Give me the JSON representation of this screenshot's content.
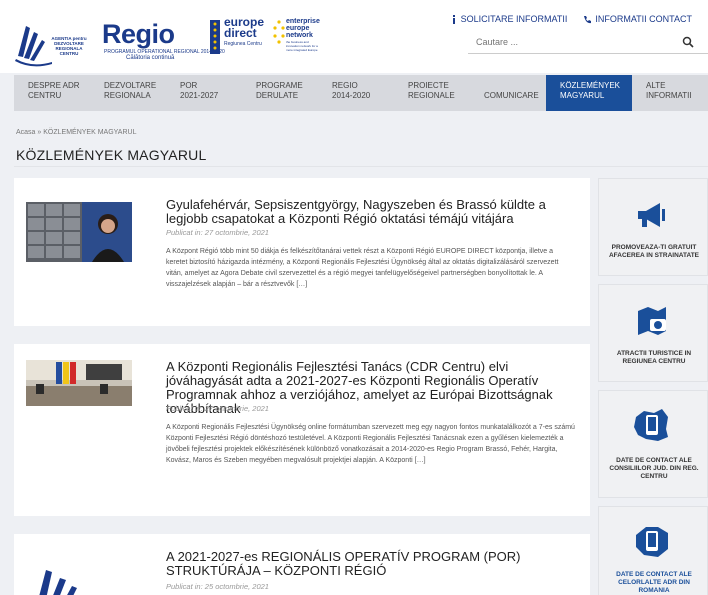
{
  "header": {
    "adr_logo_text": "AGENTIA pentru DEZVOLTARE REGIONALA CENTRU",
    "regio_logo_text": "Regio",
    "regio_logo_sub": "PROGRAMUL OPERATIONAL REGIONAL 2014-2020",
    "regio_logo_tagline": "Călătoria continuă",
    "europe_direct_line1": "europe",
    "europe_direct_line2": "direct",
    "europe_direct_sub": "Regiunea Centru",
    "een_text": "enterprise europe network",
    "een_footer": "the business and innovation network for a more integrated Europe",
    "links": [
      {
        "label": "SOLICITARE INFORMATII",
        "icon": "info-icon"
      },
      {
        "label": "INFORMATII CONTACT",
        "icon": "phone-icon"
      }
    ],
    "search_placeholder": "Cautare ..."
  },
  "nav": [
    {
      "line1": "DESPRE ADR",
      "line2": "CENTRU",
      "active": false
    },
    {
      "line1": "DEZVOLTARE",
      "line2": "REGIONALA",
      "active": false
    },
    {
      "line1": "POR",
      "line2": "2021-2027",
      "active": false
    },
    {
      "line1": "PROGRAME",
      "line2": "DERULATE",
      "active": false
    },
    {
      "line1": "REGIO",
      "line2": "2014-2020",
      "active": false
    },
    {
      "line1": "PROIECTE",
      "line2": "REGIONALE",
      "active": false
    },
    {
      "line1": "",
      "line2": "COMUNICARE",
      "active": false
    },
    {
      "line1": "KÖZLEMÉNYEK",
      "line2": "MAGYARUL",
      "active": true
    },
    {
      "line1": "ALTE",
      "line2": "INFORMATII",
      "active": false
    }
  ],
  "breadcrumb": "Acasa » KÖZLEMÉNYEK MAGYARUL",
  "page_title": "KÖZLEMÉNYEK MAGYARUL",
  "articles": [
    {
      "title": "Gyulafehérvár, Sepsiszentgyörgy, Nagyszeben és Brassó küldte a legjobb csapatokat a Központi Régió oktatási témájú vitájára",
      "date": "Publicat in: 27 octombrie, 2021",
      "excerpt": "A Központ Régió több mint 50 diákja és felkészítőtanárai vettek részt a Központi Régió EUROPE DIRECT központja, illetve a keretet biztosító házigazda intézmény, a Központi Regionális Fejlesztési Ügynökség által az oktatás digitalizálásáról szervezett vitán, amelyet az Agora Debate civil szervezettel és a régió megyei tanfelügyelőségeivel partnerségben bonyolítottak le. A visszajelzések alapján – bár a résztvevők […]"
    },
    {
      "title": "A Központi Regionális Fejlesztési Tanács (CDR Centru) elvi jóváhagyását adta a 2021-2027-es Központi Regionális Operatív Programnak ahhoz a verziójához, amelyet az Európai Bizottságnak továbbítanak",
      "date": "Publicat in: 27 octombrie, 2021",
      "excerpt": "A Központi Regionális Fejlesztési Ügynökség online formátumban szervezett meg egy nagyon fontos munkatalálkozót a 7-es számú Központi Fejlesztési Régió döntéshozó testületével. A Központi Regionális Fejlesztési Tanácsnak ezen a gyűlésen kielemezték a jövőbeli fejlesztési projektek előkészítésének különböző vonatkozásait a 2014-2020-es Regio Program Brassó, Fehér, Hargita, Kovász, Maros és Szeben megyében megvalósult projektjei alapján.   A Központi […]"
    },
    {
      "title": "A 2021-2027-es REGIONÁLIS OPERATÍV PROGRAM (POR) STRUKTÚRÁJA – KÖZPONTI RÉGIÓ",
      "date": "Publicat in: 25 octombrie, 2021",
      "excerpt": ""
    }
  ],
  "sidebar": [
    {
      "label": "PROMOVEAZA-TI GRATUIT AFACEREA IN STRAINATATE",
      "icon": "megaphone-icon"
    },
    {
      "label": "ATRACTII TURISTICE IN REGIUNEA CENTRU",
      "icon": "map-photo-icon"
    },
    {
      "label": "DATE DE CONTACT ALE CONSILIILOR JUD. DIN REG. CENTRU",
      "icon": "region-phone-icon"
    },
    {
      "label": "DATE DE CONTACT ALE CELORLALTE ADR DIN ROMANIA",
      "icon": "country-phone-icon"
    }
  ],
  "colors": {
    "brand_blue": "#1a4f9a",
    "nav_bg": "#d7d9de",
    "page_bg": "#eef0f4"
  }
}
